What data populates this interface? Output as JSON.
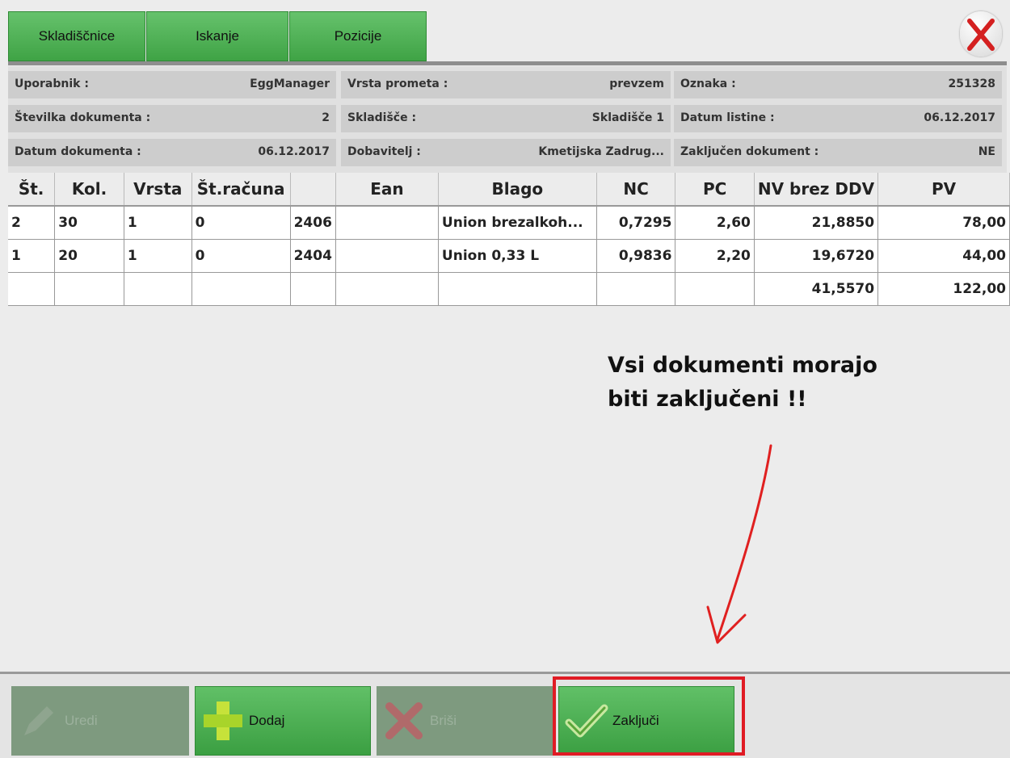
{
  "tabs": [
    {
      "label": "Skladiščnice"
    },
    {
      "label": "Iskanje"
    },
    {
      "label": "Pozicije"
    }
  ],
  "info": {
    "uporabnik": {
      "label": "Uporabnik :",
      "value": "EggManager"
    },
    "vrsta_prometa": {
      "label": "Vrsta prometa :",
      "value": "prevzem"
    },
    "oznaka": {
      "label": "Oznaka :",
      "value": "251328"
    },
    "stevilka_dokumenta": {
      "label": "Številka dokumenta :",
      "value": "2"
    },
    "skladisce": {
      "label": "Skladišče :",
      "value": "Skladišče 1"
    },
    "datum_listine": {
      "label": "Datum listine :",
      "value": "06.12.2017"
    },
    "datum_dokumenta": {
      "label": "Datum dokumenta :",
      "value": "06.12.2017"
    },
    "dobavitelj": {
      "label": "Dobavitelj :",
      "value": "Kmetijska Zadrug..."
    },
    "zakljucen_dokument": {
      "label": "Zaključen dokument :",
      "value": "NE"
    }
  },
  "table": {
    "headers": [
      "Št.",
      "Kol.",
      "Vrsta",
      "Št.računa",
      "",
      "Ean",
      "Blago",
      "NC",
      "PC",
      "NV brez DDV",
      "PV"
    ],
    "rows": [
      [
        "2",
        "30",
        "1",
        "0",
        "2406",
        "",
        "Union brezalkoh...",
        "0,7295",
        "2,60",
        "21,8850",
        "78,00"
      ],
      [
        "1",
        "20",
        "1",
        "0",
        "2404",
        "",
        "Union 0,33 L",
        "0,9836",
        "2,20",
        "19,6720",
        "44,00"
      ]
    ],
    "totals": {
      "nv": "41,5570",
      "pv": "122,00"
    }
  },
  "annotation": {
    "line1": "Vsi dokumenti morajo",
    "line2": "biti zaključeni !!"
  },
  "toolbar": {
    "uredi": "Uredi",
    "dodaj": "Dodaj",
    "brisi": "Briši",
    "zakljuci": "Zaključi"
  },
  "colors": {
    "green": "#4caf50",
    "highlight": "#e01b24",
    "arrow": "#e02020"
  }
}
